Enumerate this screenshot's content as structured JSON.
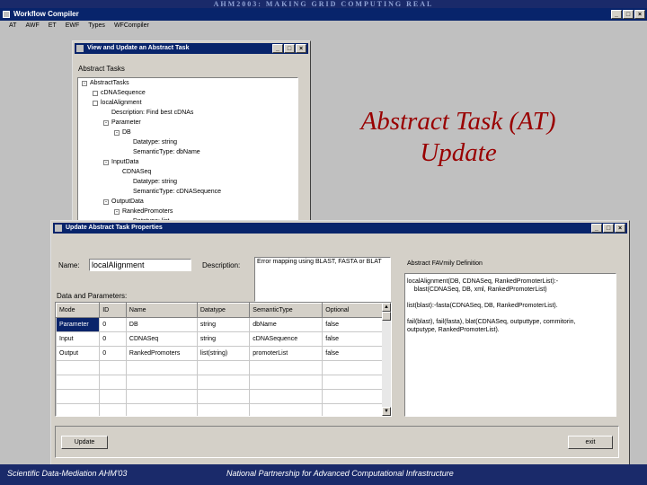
{
  "slide": {
    "banner": "AHM2003: MAKING GRID COMPUTING REAL",
    "overlay_line1": "Abstract Task (AT)",
    "overlay_line2": "Update",
    "footer_left": "Scientific Data-Mediation AHM'03",
    "footer_right": "National Partnership for Advanced Computational Infrastructure"
  },
  "main_window": {
    "title": "Workflow Compiler",
    "menu": [
      "AT",
      "AWF",
      "ET",
      "EWF",
      "Types",
      "WFCompiler"
    ]
  },
  "view_window": {
    "title": "View and Update an Abstract Task",
    "group_label": "Abstract Tasks",
    "tree": [
      {
        "text": "AbstractTasks",
        "level": 0,
        "box": "-"
      },
      {
        "text": "cDNASequence",
        "level": 1,
        "box": ""
      },
      {
        "text": "localAlignment",
        "level": 1,
        "box": ""
      },
      {
        "text": "Description: Find best cDNAs",
        "level": 2,
        "box": ""
      },
      {
        "text": "Parameter",
        "level": 2,
        "box": "-"
      },
      {
        "text": "DB",
        "level": 3,
        "box": "-"
      },
      {
        "text": "Datatype: string",
        "level": 4,
        "box": ""
      },
      {
        "text": "SemanticType: dbName",
        "level": 4,
        "box": ""
      },
      {
        "text": "InputData",
        "level": 2,
        "box": "-"
      },
      {
        "text": "CDNASeq",
        "level": 3,
        "box": ""
      },
      {
        "text": "Datatype: string",
        "level": 4,
        "box": ""
      },
      {
        "text": "SemanticType: cDNASequence",
        "level": 4,
        "box": ""
      },
      {
        "text": "OutputData",
        "level": 2,
        "box": "-"
      },
      {
        "text": "RankedPromoters",
        "level": 3,
        "box": "-"
      },
      {
        "text": "Datatype: list",
        "level": 4,
        "box": ""
      }
    ]
  },
  "update_window": {
    "title": "Update Abstract Task Properties",
    "name_label": "Name:",
    "name_value": "localAlignment",
    "description_label": "Description:",
    "description_value": "Error mapping using BLAST, FASTA or BLAT",
    "params_label": "Data and Parameters:",
    "table": {
      "headers": [
        "Mode",
        "ID",
        "Name",
        "Datatype",
        "SemanticType",
        "Optional"
      ],
      "rows": [
        [
          "Parameter",
          "0",
          "DB",
          "string",
          "dbName",
          "false"
        ],
        [
          "Input",
          "0",
          "CDNASeq",
          "string",
          "cDNASequence",
          "false"
        ],
        [
          "Output",
          "0",
          "RankedPromoters",
          "list(string)",
          "promoterList",
          "false"
        ]
      ]
    },
    "def_label": "Abstract FAVmily Definition",
    "definition": "localAlignment(DB, CDNASeq, RankedPromoterList):-\n    blast(CDNASeq, DB, xml, RankedPromoterList)\n\nlist(blast):-fasta(CDNASeq, DB, RankedPromoterList).\n\nfail(blast), fail(fasta), blat(CDNASeq, outputtype, commitorin,\noutputype, RankedPromoterList).",
    "update_button": "Update",
    "exit_button": "exit"
  },
  "colors": {
    "title_bar": "#08246b",
    "window_face": "#d4d0c8",
    "overlay_text": "#990000",
    "slide_band": "#1a2a6a"
  }
}
